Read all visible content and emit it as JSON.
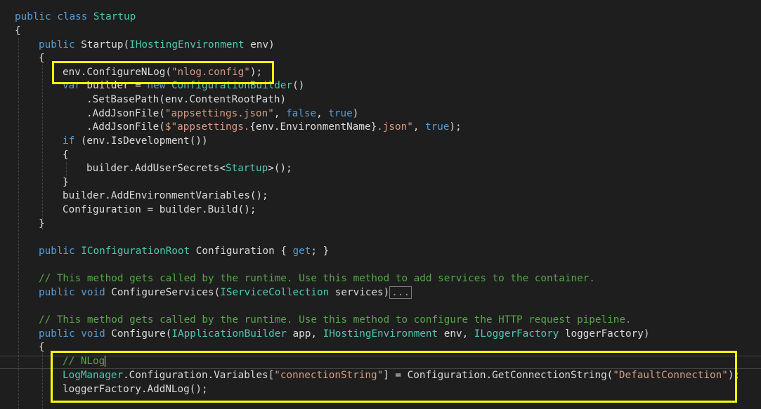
{
  "code": {
    "l1_public": "public",
    "l1_class": "class",
    "l1_name": "Startup",
    "l2_brace": "{",
    "l3_public": "public",
    "l3_ctor": " Startup(",
    "l3_type": "IHostingEnvironment",
    "l3_rest": " env)",
    "l4_brace": "{",
    "l5_text": "env.ConfigureNLog(",
    "l5_str": "\"nlog.config\"",
    "l5_end": ");",
    "l6_var": "var",
    "l6_mid": " builder = ",
    "l6_new": "new",
    "l6_type": "ConfigurationBuilder",
    "l6_end": "()",
    "l7_text": ".SetBasePath(env.ContentRootPath)",
    "l8_a": ".AddJsonFile(",
    "l8_str": "\"appsettings.json\"",
    "l8_b": ", ",
    "l8_false": "false",
    "l8_c": ", ",
    "l8_true": "true",
    "l8_d": ")",
    "l9_a": ".AddJsonFile(",
    "l9_s1": "$\"appsettings.",
    "l9_mid": "{env.EnvironmentName}",
    "l9_s2": ".json\"",
    "l9_b": ", ",
    "l9_true": "true",
    "l9_c": ");",
    "l10_if": "if",
    "l10_rest": " (env.IsDevelopment())",
    "l11_brace": "{",
    "l12_a": "builder.AddUserSecrets<",
    "l12_type": "Startup",
    "l12_b": ">();",
    "l13_brace": "}",
    "l14_text": "builder.AddEnvironmentVariables();",
    "l15_text": "Configuration = builder.Build();",
    "l16_brace": "}",
    "l18_public": "public",
    "l18_type": "IConfigurationRoot",
    "l18_a": " Configuration { ",
    "l18_get": "get",
    "l18_b": "; }",
    "l20_comment": "// This method gets called by the runtime. Use this method to add services to the container.",
    "l21_public": "public",
    "l21_void": "void",
    "l21_a": " ConfigureServices(",
    "l21_type": "IServiceCollection",
    "l21_b": " services)",
    "l21_collapsed": "...",
    "l23_comment": "// This method gets called by the runtime. Use this method to configure the HTTP request pipeline.",
    "l24_public": "public",
    "l24_void": "void",
    "l24_a": " Configure(",
    "l24_t1": "IApplicationBuilder",
    "l24_b": " app, ",
    "l24_t2": "IHostingEnvironment",
    "l24_c": " env, ",
    "l24_t3": "ILoggerFactory",
    "l24_d": " loggerFactory)",
    "l25_brace": "{",
    "l26_comment": "// NLog",
    "l27_type": "LogManager",
    "l27_a": ".Configuration.Variables[",
    "l27_str1": "\"connectionString\"",
    "l27_b": "] = Configuration.GetConnectionString(",
    "l27_str2": "\"DefaultConnection\"",
    "l27_c": ");",
    "l28_text": "loggerFactory.AddNLog();"
  },
  "colors": {
    "background": "#1e1e1e",
    "keyword": "#569cd6",
    "type": "#4ec9b0",
    "string": "#d69d85",
    "comment": "#57a64a",
    "text": "#dcdcdc",
    "highlight_box": "#ffff00"
  }
}
